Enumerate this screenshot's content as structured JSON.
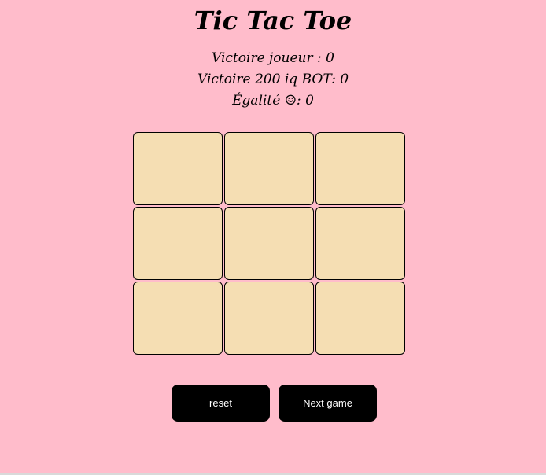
{
  "title": "Tic Tac Toe",
  "scores": {
    "player": "Victoire joueur : 0",
    "bot": "Victoire 200 iq BOT: 0",
    "draw": "Égalité ☺: 0"
  },
  "board": {
    "cells": [
      "",
      "",
      "",
      "",
      "",
      "",
      "",
      "",
      ""
    ]
  },
  "buttons": {
    "reset": "reset",
    "next": "Next game"
  },
  "colors": {
    "background": "#ffbccb",
    "cell": "#f5deb3",
    "button": "#000000",
    "button_text": "#ffffff"
  }
}
